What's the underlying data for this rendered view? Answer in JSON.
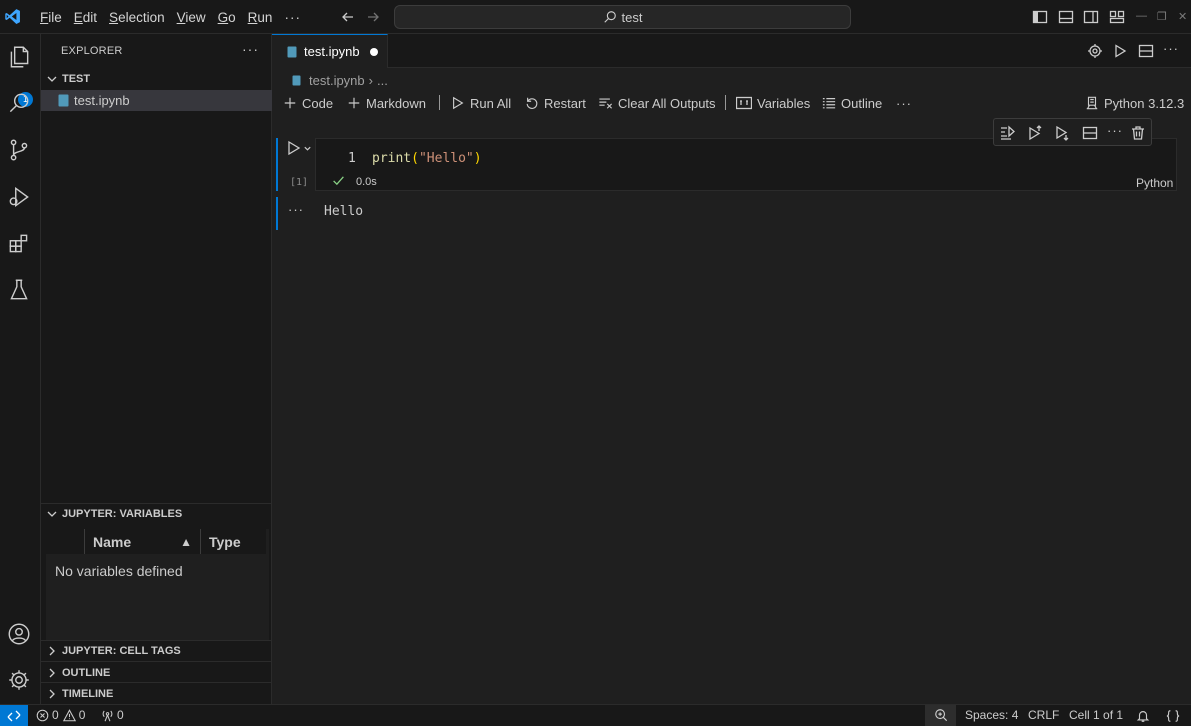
{
  "titlebar": {
    "menu": [
      "File",
      "Edit",
      "Selection",
      "View",
      "Go",
      "Run"
    ],
    "more": "···",
    "search_text": "test"
  },
  "activity": {
    "explorer_badge": "1",
    "icons": [
      "explorer-icon",
      "search-icon",
      "source-control-icon",
      "run-debug-icon",
      "extensions-icon",
      "testing-icon",
      "account-icon",
      "manage-gear-icon"
    ]
  },
  "sidebar": {
    "title": "EXPLORER",
    "more": "···",
    "folder": "TEST",
    "file": "test.ipynb",
    "variables_section": "JUPYTER: VARIABLES",
    "variables_columns": {
      "name": "Name",
      "sort": "▲",
      "type": "Type"
    },
    "variables_empty": "No variables defined",
    "cell_tags_section": "JUPYTER: CELL TAGS",
    "outline_section": "OUTLINE",
    "timeline_section": "TIMELINE"
  },
  "editor": {
    "tab_name": "test.ipynb",
    "breadcrumb_file": "test.ipynb",
    "breadcrumb_more": "...",
    "toolbar": {
      "code": "Code",
      "markdown": "Markdown",
      "run_all": "Run All",
      "restart": "Restart",
      "clear_outputs": "Clear All Outputs",
      "variables": "Variables",
      "outline": "Outline",
      "more": "···",
      "kernel": "Python 3.12.3"
    },
    "cell": {
      "exec_count": "[1]",
      "line_number": "1",
      "code_fn": "print",
      "code_open": "(",
      "code_str": "\"Hello\"",
      "code_close": ")",
      "duration": "0.0s",
      "language": "Python",
      "toolbar_more": "···",
      "output_more": "···",
      "output": "Hello"
    }
  },
  "statusbar": {
    "errors": "0",
    "warnings": "0",
    "ports": "0",
    "spaces": "Spaces: 4",
    "eol": "CRLF",
    "cell_position": "Cell 1 of 1"
  },
  "colors": {
    "accent": "#0078d4",
    "background": "#1f1f1f",
    "sidebar": "#181818",
    "success": "#89d185"
  }
}
